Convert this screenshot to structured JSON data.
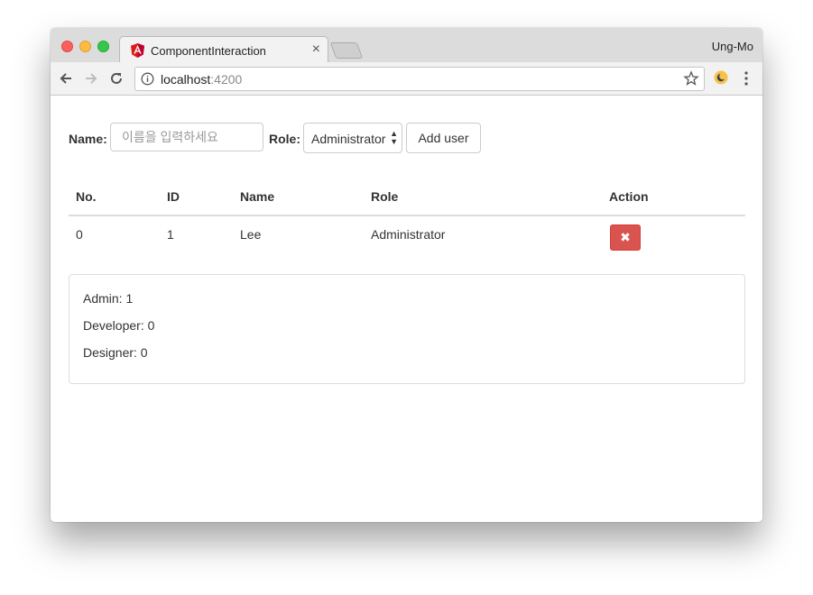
{
  "browser": {
    "tab_title": "ComponentInteraction",
    "profile_name": "Ung-Mo",
    "url_host": "localhost",
    "url_port": ":4200"
  },
  "form": {
    "name_label": "Name:",
    "name_placeholder": "이름을 입력하세요",
    "role_label": "Role:",
    "role_selected": "Administrator",
    "add_button": "Add user"
  },
  "table": {
    "headers": [
      "No.",
      "ID",
      "Name",
      "Role",
      "Action"
    ],
    "rows": [
      {
        "no": "0",
        "id": "1",
        "name": "Lee",
        "role": "Administrator",
        "action": "✖"
      }
    ]
  },
  "stats": {
    "admin": "Admin: 1",
    "developer": "Developer: 0",
    "designer": "Designer: 0"
  },
  "colors": {
    "delete_button": "#d9534f",
    "angular_red": "#dd1b16"
  }
}
